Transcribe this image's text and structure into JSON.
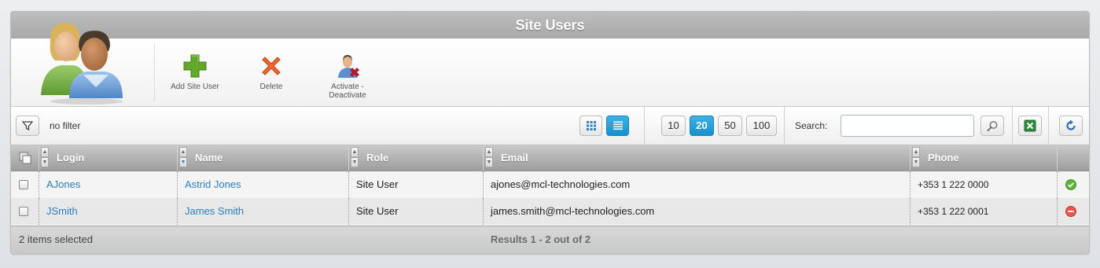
{
  "window": {
    "title": "Site Users"
  },
  "ribbon": {
    "logo_icon": "users-group-icon",
    "buttons": [
      {
        "label": "Add Site User",
        "icon": "plus-icon",
        "color": "#5a9a1e"
      },
      {
        "label": "Delete",
        "icon": "delete-x-icon",
        "color": "#e0541f"
      },
      {
        "label_line1": "Activate -",
        "label_line2": "Deactivate",
        "icon": "user-deactivate-icon"
      }
    ]
  },
  "toolbar": {
    "filter_icon": "filter-icon",
    "filter_text": "no filter",
    "view_grid_icon": "grid-view-icon",
    "view_list_icon": "list-view-icon",
    "page_sizes": [
      "10",
      "20",
      "50",
      "100"
    ],
    "page_size_selected": "20",
    "search_label": "Search:",
    "search_value": "",
    "search_icon": "magnifier-icon",
    "excel_icon": "excel-export-icon",
    "refresh_icon": "refresh-icon",
    "accent_color": "#1890d0"
  },
  "grid": {
    "columns": [
      "Login",
      "Name",
      "Role",
      "Email",
      "Phone"
    ],
    "rows": [
      {
        "login": "AJones",
        "name": "Astrid Jones",
        "role": "Site User",
        "email": "ajones@mcl-technologies.com",
        "phone": "+353 1 222 0000",
        "status": "active",
        "status_icon": "check-circle-icon"
      },
      {
        "login": "JSmith",
        "name": "James Smith",
        "role": "Site User",
        "email": "james.smith@mcl-technologies.com",
        "phone": "+353 1 222 0001",
        "status": "inactive",
        "status_icon": "minus-circle-icon"
      }
    ]
  },
  "footer": {
    "selected_text": "2 items selected",
    "results_text": "Results 1 - 2 out of 2"
  }
}
